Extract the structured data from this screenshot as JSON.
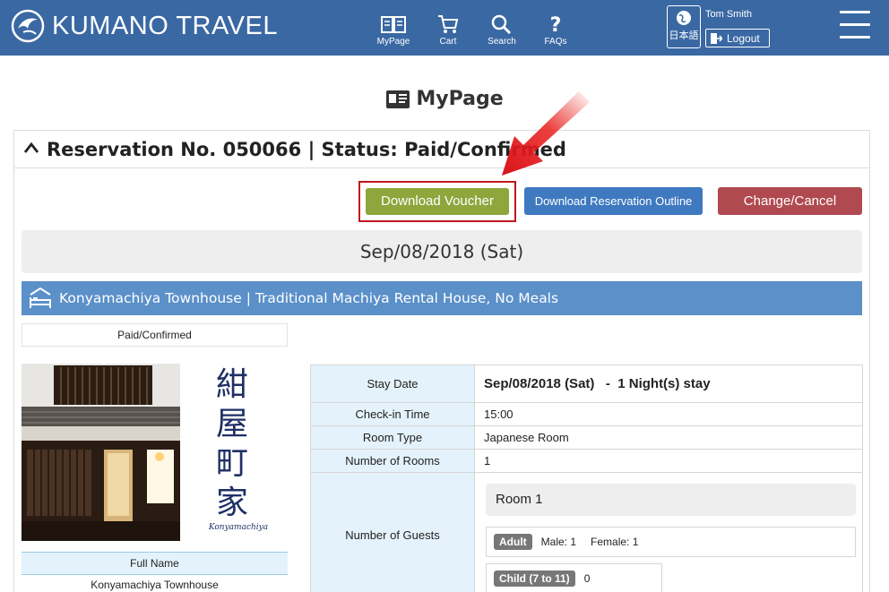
{
  "header": {
    "brand": "KUMANO TRAVEL",
    "nav": [
      {
        "label": "MyPage",
        "icon": "book-icon"
      },
      {
        "label": "Cart",
        "icon": "cart-icon"
      },
      {
        "label": "Search",
        "icon": "search-icon"
      },
      {
        "label": "FAQs",
        "icon": "question-icon"
      }
    ],
    "language_label": "日本語",
    "user_name": "Tom Smith",
    "logout_label": "Logout"
  },
  "page": {
    "title": "MyPage"
  },
  "reservation": {
    "title": "Reservation No. 050066 | Status: Paid/Confirmed",
    "buttons": {
      "voucher": "Download Voucher",
      "outline": "Download Reservation Outline",
      "change": "Change/Cancel"
    },
    "date": "Sep/08/2018 (Sat)",
    "hotel_title": "Konyamachiya Townhouse | Traditional Machiya Rental House, No Meals",
    "status": "Paid/Confirmed",
    "brand_kanji": [
      "紺",
      "屋",
      "町",
      "家"
    ],
    "brand_sub": "Konyamachiya",
    "full_name_label": "Full Name",
    "full_name_value": "Konyamachiya Townhouse",
    "details": {
      "stay_date_label": "Stay Date",
      "stay_date_value": "Sep/08/2018 (Sat)   -  1 Night(s) stay",
      "checkin_label": "Check-in Time",
      "checkin_value": "15:00",
      "room_type_label": "Room Type",
      "room_type_value": "Japanese Room",
      "rooms_label": "Number of Rooms",
      "rooms_value": "1",
      "guests_label": "Number of Guests",
      "room_name": "Room 1",
      "adult_tag": "Adult",
      "male_text": "Male: 1",
      "female_text": "Female: 1",
      "child_tag": "Child (7 to 11)",
      "child_value": "0"
    }
  },
  "colors": {
    "header_bg": "#3a68a3",
    "voucher_btn": "#8ea63c",
    "outline_btn": "#3f79c0",
    "cancel_btn": "#b04a50",
    "hotel_bar": "#5b90c9",
    "highlight_frame": "#c0161c"
  }
}
